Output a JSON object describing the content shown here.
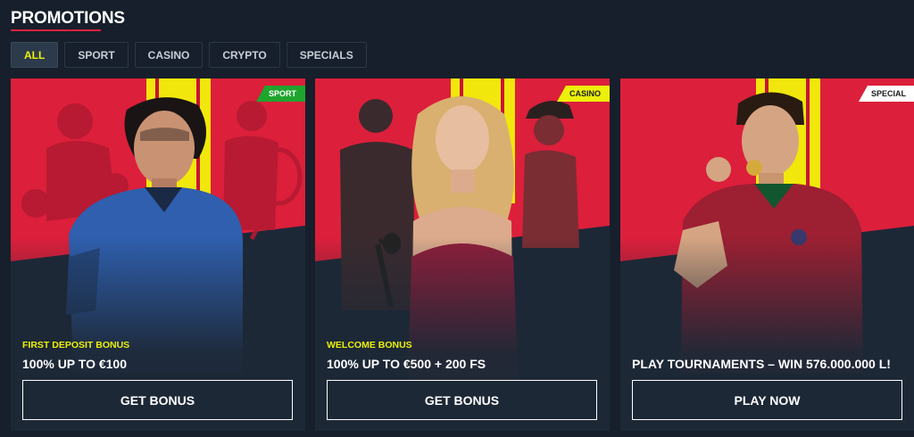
{
  "header": {
    "title": "PROMOTIONS"
  },
  "filters": [
    {
      "label": "ALL",
      "active": true
    },
    {
      "label": "SPORT",
      "active": false
    },
    {
      "label": "CASINO",
      "active": false
    },
    {
      "label": "CRYPTO",
      "active": false
    },
    {
      "label": "SPECIALS",
      "active": false
    }
  ],
  "cards": [
    {
      "badge": "SPORT",
      "badge_bg": "#1fa52d",
      "badge_color": "#ffffff",
      "subtitle": "FIRST DEPOSIT BONUS",
      "headline": "100% UP TO €100",
      "button": "GET BONUS"
    },
    {
      "badge": "CASINO",
      "badge_bg": "#ecf00a",
      "badge_color": "#1b1b1b",
      "subtitle": "WELCOME BONUS",
      "headline": "100% UP TO €500 + 200 FS",
      "button": "GET BONUS"
    },
    {
      "badge": "SPECIAL",
      "badge_bg": "#ffffff",
      "badge_color": "#1b1b1b",
      "subtitle": "",
      "headline": "PLAY TOURNAMENTS – WIN 576.000.000 L!",
      "button": "PLAY NOW"
    }
  ],
  "colors": {
    "background": "#161f2b",
    "accent_red": "#e0213a",
    "accent_yellow": "#ecf00a",
    "promo_red": "#e0213a"
  }
}
